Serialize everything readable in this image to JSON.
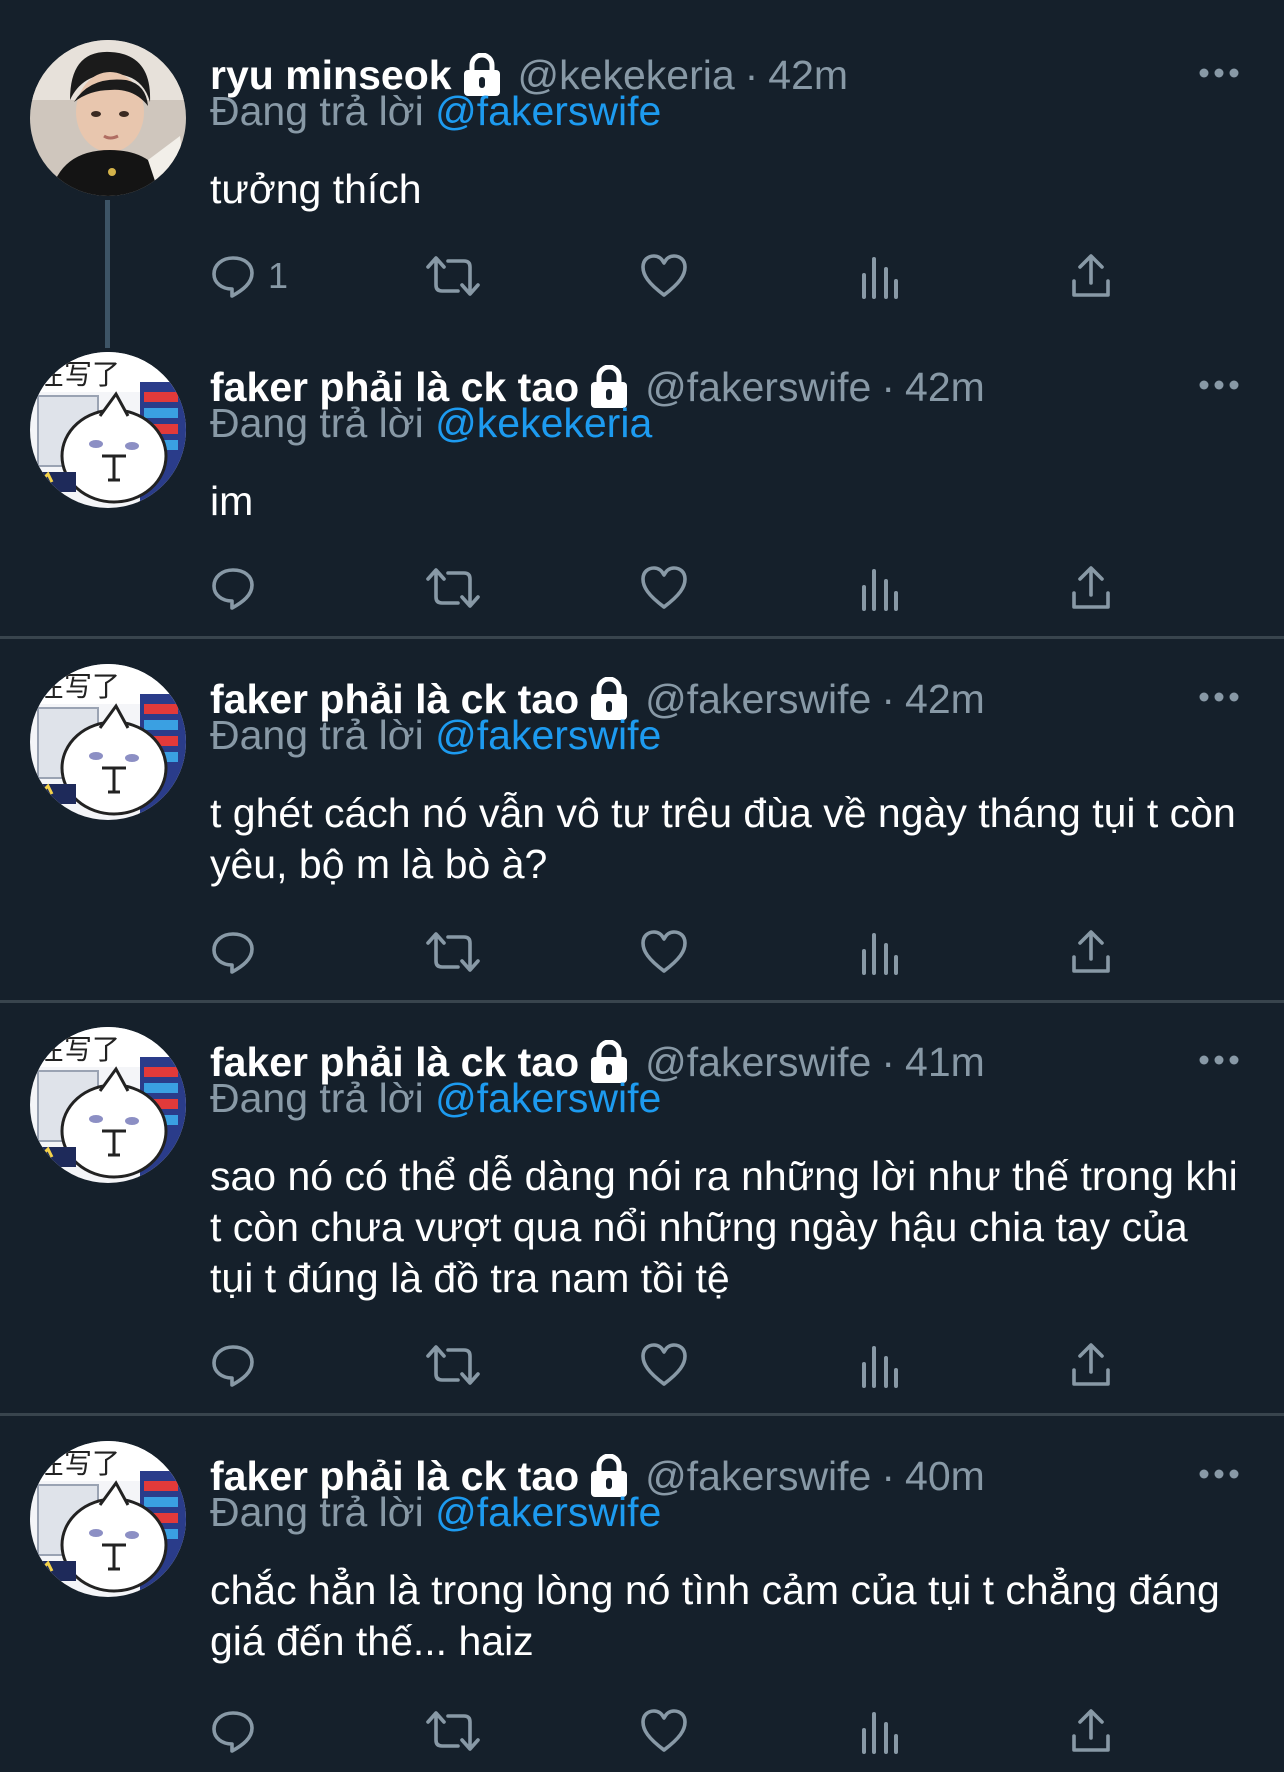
{
  "tweets": [
    {
      "name": "ryu minseok",
      "handle": "@kekekeria",
      "time": "42m",
      "replying_prefix": "Đang trả lời",
      "reply_to": "@fakerswife",
      "text": "tưởng thích",
      "reply_count": "1",
      "avatar": "person-photo"
    },
    {
      "name": "faker phải là ck tao",
      "handle": "@fakerswife",
      "time": "42m",
      "replying_prefix": "Đang trả lời",
      "reply_to": "@kekekeria",
      "text": "im",
      "reply_count": "",
      "avatar": "cartoon-cat"
    },
    {
      "name": "faker phải là ck tao",
      "handle": "@fakerswife",
      "time": "42m",
      "replying_prefix": "Đang trả lời",
      "reply_to": "@fakerswife",
      "text": "t ghét cách nó vẫn vô tư trêu đùa về ngày tháng tụi t còn yêu, bộ m là bò à?",
      "reply_count": "",
      "avatar": "cartoon-cat"
    },
    {
      "name": "faker phải là ck tao",
      "handle": "@fakerswife",
      "time": "41m",
      "replying_prefix": "Đang trả lời",
      "reply_to": "@fakerswife",
      "text": "sao nó có thể dễ dàng nói ra những lời như thế trong khi t còn chưa vượt qua nổi những ngày hậu chia tay của tụi t đúng là đồ tra nam tồi tệ",
      "reply_count": "",
      "avatar": "cartoon-cat"
    },
    {
      "name": "faker phải là ck tao",
      "handle": "@fakerswife",
      "time": "40m",
      "replying_prefix": "Đang trả lời",
      "reply_to": "@fakerswife",
      "text": "chắc hẳn là trong lòng nó tình cảm của tụi t chẳng đáng giá đến thế... haiz",
      "reply_count": "",
      "avatar": "cartoon-cat"
    }
  ],
  "avatar_text": "在写了",
  "separator": "·",
  "icons": [
    "lock-icon",
    "more-icon",
    "reply-icon",
    "retweet-icon",
    "like-icon",
    "views-icon",
    "share-icon"
  ],
  "colors": {
    "background": "#15202b",
    "text": "#ffffff",
    "secondary": "#8899a6",
    "link": "#1d9bf0",
    "divider": "#38444d",
    "thread_line": "#3d5466"
  }
}
